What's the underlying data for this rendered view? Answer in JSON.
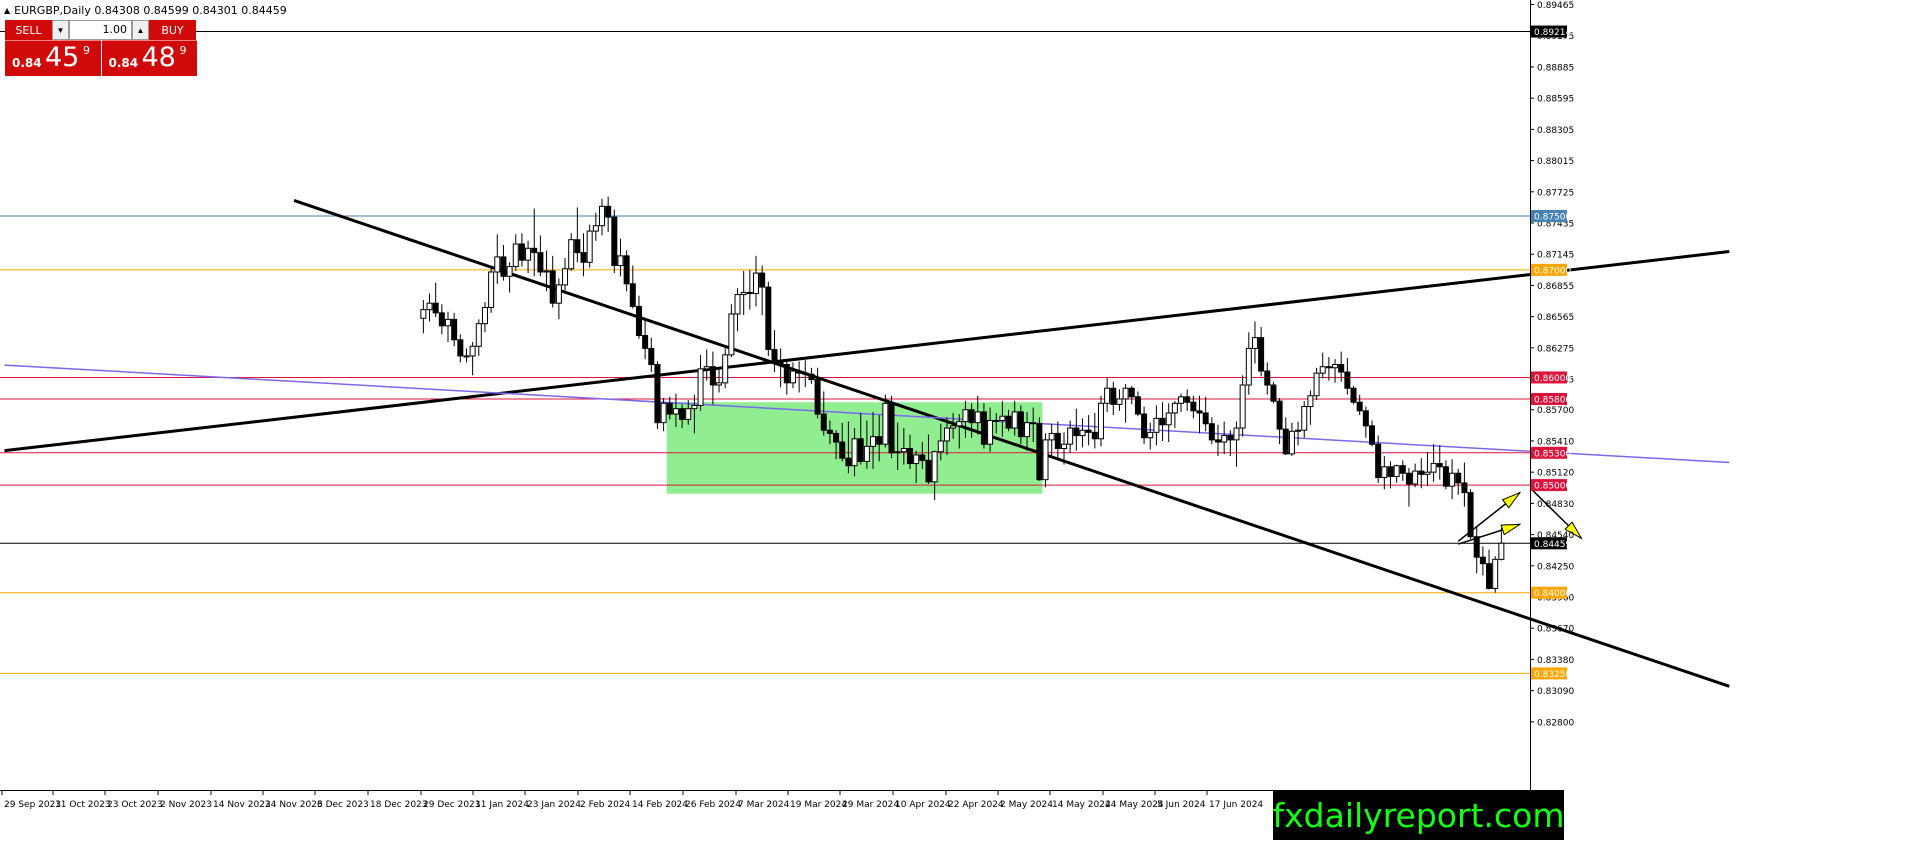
{
  "header": {
    "symbol_line": "EURGBP,Daily  0.84308 0.84599 0.84301 0.84459"
  },
  "trade_panel": {
    "sell_label": "SELL",
    "buy_label": "BUY",
    "lot": "1.00",
    "sell_small": "0.84",
    "sell_big": "45",
    "sell_sup": "9",
    "buy_small": "0.84",
    "buy_big": "48",
    "buy_sup": "9"
  },
  "watermark": "fxdailyreport.com",
  "colors": {
    "candle": "#000000",
    "orange_level": "#ffa500",
    "red_level": "#dc143c",
    "blue_level": "#4682b4",
    "ma_line": "#7b68ee",
    "range_box": "#90ee90",
    "arrow_fill": "#ffff00",
    "trade_red": "#d00a0a",
    "watermark_bg": "#000000",
    "watermark_text": "#12ff12"
  },
  "chart_data": {
    "type": "candlestick",
    "symbol": "EURGBP",
    "timeframe": "Daily",
    "y_range": [
      0.8265,
      0.8947
    ],
    "y_ticks": [
      "0.89465",
      "0.89175",
      "0.88885",
      "0.88595",
      "0.88305",
      "0.88015",
      "0.87725",
      "0.87435",
      "0.87145",
      "0.86855",
      "0.86565",
      "0.86275",
      "0.85985",
      "0.85700",
      "0.85410",
      "0.85120",
      "0.84830",
      "0.84540",
      "0.84250",
      "0.83960",
      "0.83670",
      "0.83380",
      "0.83090",
      "0.82800"
    ],
    "x_labels": [
      "29 Sep 2023",
      "11 Oct 2023",
      "23 Oct 2023",
      "2 Nov 2023",
      "14 Nov 2023",
      "24 Nov 2023",
      "6 Dec 2023",
      "18 Dec 2023",
      "29 Dec 2023",
      "11 Jan 2024",
      "23 Jan 2024",
      "2 Feb 2024",
      "14 Feb 2024",
      "26 Feb 2024",
      "7 Mar 2024",
      "19 Mar 2024",
      "29 Mar 2024",
      "10 Apr 2024",
      "22 Apr 2024",
      "2 May 2024",
      "14 May 2024",
      "24 May 2024",
      "5 Jun 2024",
      "17 Jun 2024"
    ],
    "levels": [
      {
        "price": 0.89214,
        "label": "0.89214",
        "color": "#000000"
      },
      {
        "price": 0.875,
        "label": "0.87500",
        "color": "#4682b4"
      },
      {
        "price": 0.87,
        "label": "0.87000",
        "color": "#ffa500"
      },
      {
        "price": 0.86,
        "label": "0.86000",
        "color": "#dc143c"
      },
      {
        "price": 0.858,
        "label": "0.85800",
        "color": "#dc143c"
      },
      {
        "price": 0.853,
        "label": "0.85300",
        "color": "#dc143c"
      },
      {
        "price": 0.85,
        "label": "0.85000",
        "color": "#dc143c"
      },
      {
        "price": 0.84459,
        "label": "0.84459",
        "color": "#000000"
      },
      {
        "price": 0.84,
        "label": "0.84000",
        "color": "#ffa500"
      },
      {
        "price": 0.8325,
        "label": "0.83250",
        "color": "#ffa500"
      }
    ],
    "trendlines": [
      {
        "name": "descending",
        "from": [
          0,
          0.87645
        ],
        "to": [
          233,
          0.8313
        ]
      },
      {
        "name": "ascending",
        "from": [
          -47,
          0.8532
        ],
        "to": [
          233,
          0.8717
        ]
      },
      {
        "name": "moving-average",
        "from": [
          -47,
          0.86115
        ],
        "to": [
          233,
          0.8521
        ]
      }
    ],
    "range_box": {
      "from": 61,
      "to": 121,
      "top": 0.8577,
      "bottom": 0.8492
    },
    "arrows": [
      {
        "from": [
          189,
          0.84478
        ],
        "to": [
          199,
          0.8493
        ]
      },
      {
        "from": [
          189,
          0.84452
        ],
        "to": [
          199,
          0.84635
        ]
      },
      {
        "from": [
          201,
          0.84955
        ],
        "to": [
          209,
          0.84505
        ]
      }
    ],
    "candles": [
      [
        0.8655,
        0.8672,
        0.8641,
        0.8663
      ],
      [
        0.8663,
        0.8678,
        0.8652,
        0.8669
      ],
      [
        0.8669,
        0.8688,
        0.8656,
        0.866
      ],
      [
        0.866,
        0.8668,
        0.864,
        0.8648
      ],
      [
        0.8648,
        0.8661,
        0.8633,
        0.8654
      ],
      [
        0.8654,
        0.866,
        0.8629,
        0.8635
      ],
      [
        0.8635,
        0.864,
        0.8614,
        0.862
      ],
      [
        0.862,
        0.8627,
        0.8614,
        0.862
      ],
      [
        0.862,
        0.8633,
        0.8602,
        0.8629
      ],
      [
        0.8629,
        0.8654,
        0.862,
        0.865
      ],
      [
        0.865,
        0.867,
        0.8642,
        0.8665
      ],
      [
        0.8665,
        0.8703,
        0.866,
        0.8698
      ],
      [
        0.8698,
        0.8733,
        0.8687,
        0.8712
      ],
      [
        0.8712,
        0.8723,
        0.869,
        0.8694
      ],
      [
        0.8694,
        0.8707,
        0.8679,
        0.8703
      ],
      [
        0.8703,
        0.8733,
        0.8699,
        0.8724
      ],
      [
        0.8724,
        0.8734,
        0.8703,
        0.8709
      ],
      [
        0.8709,
        0.8727,
        0.8697,
        0.872
      ],
      [
        0.872,
        0.8757,
        0.8694,
        0.8716
      ],
      [
        0.8716,
        0.8732,
        0.8694,
        0.8698
      ],
      [
        0.8698,
        0.8718,
        0.868,
        0.8699
      ],
      [
        0.8699,
        0.8713,
        0.8665,
        0.8669
      ],
      [
        0.8669,
        0.8692,
        0.8654,
        0.8686
      ],
      [
        0.8686,
        0.8711,
        0.8681,
        0.8701
      ],
      [
        0.8701,
        0.8734,
        0.8699,
        0.8728
      ],
      [
        0.8728,
        0.8758,
        0.8707,
        0.8716
      ],
      [
        0.8716,
        0.8734,
        0.8694,
        0.8707
      ],
      [
        0.8707,
        0.8742,
        0.8702,
        0.8736
      ],
      [
        0.8736,
        0.8753,
        0.8727,
        0.8741
      ],
      [
        0.8741,
        0.8766,
        0.8732,
        0.8759
      ],
      [
        0.8759,
        0.8768,
        0.8735,
        0.8749
      ],
      [
        0.8749,
        0.8756,
        0.8697,
        0.8704
      ],
      [
        0.8704,
        0.8729,
        0.8694,
        0.8713
      ],
      [
        0.8713,
        0.8718,
        0.868,
        0.8687
      ],
      [
        0.8687,
        0.8704,
        0.8664,
        0.8666
      ],
      [
        0.8666,
        0.8676,
        0.8636,
        0.8639
      ],
      [
        0.8639,
        0.8654,
        0.8617,
        0.8627
      ],
      [
        0.8627,
        0.8637,
        0.8605,
        0.8612
      ],
      [
        0.8612,
        0.8615,
        0.8552,
        0.8558
      ],
      [
        0.8558,
        0.8581,
        0.855,
        0.8576
      ],
      [
        0.8576,
        0.8582,
        0.8561,
        0.8566
      ],
      [
        0.8566,
        0.8585,
        0.8554,
        0.8571
      ],
      [
        0.8571,
        0.8575,
        0.8553,
        0.8561
      ],
      [
        0.8561,
        0.8579,
        0.8556,
        0.8571
      ],
      [
        0.8571,
        0.8584,
        0.8548,
        0.8574
      ],
      [
        0.8574,
        0.8621,
        0.8569,
        0.8608
      ],
      [
        0.8608,
        0.8626,
        0.8597,
        0.861
      ],
      [
        0.861,
        0.8624,
        0.8575,
        0.8593
      ],
      [
        0.8593,
        0.8608,
        0.8586,
        0.8595
      ],
      [
        0.8595,
        0.8629,
        0.859,
        0.8621
      ],
      [
        0.8621,
        0.8668,
        0.8619,
        0.8659
      ],
      [
        0.8659,
        0.8683,
        0.8643,
        0.8677
      ],
      [
        0.8677,
        0.8699,
        0.8658,
        0.8679
      ],
      [
        0.8679,
        0.87,
        0.8663,
        0.8678
      ],
      [
        0.8678,
        0.8713,
        0.8666,
        0.8697
      ],
      [
        0.8697,
        0.8704,
        0.8658,
        0.8684
      ],
      [
        0.8684,
        0.8689,
        0.862,
        0.8626
      ],
      [
        0.8626,
        0.8644,
        0.8605,
        0.8615
      ],
      [
        0.8615,
        0.8627,
        0.8591,
        0.8612
      ],
      [
        0.8612,
        0.8615,
        0.8584,
        0.8595
      ],
      [
        0.8595,
        0.8614,
        0.859,
        0.8606
      ],
      [
        0.8606,
        0.8615,
        0.8586,
        0.8604
      ],
      [
        0.8604,
        0.8616,
        0.8591,
        0.8603
      ],
      [
        0.8603,
        0.8609,
        0.8594,
        0.8598
      ],
      [
        0.8598,
        0.8609,
        0.8562,
        0.8566
      ],
      [
        0.8566,
        0.8587,
        0.8546,
        0.8551
      ],
      [
        0.8551,
        0.856,
        0.8538,
        0.8548
      ],
      [
        0.8548,
        0.8551,
        0.8524,
        0.854
      ],
      [
        0.854,
        0.8558,
        0.8522,
        0.8525
      ],
      [
        0.8525,
        0.8559,
        0.8511,
        0.8518
      ],
      [
        0.8518,
        0.8553,
        0.8508,
        0.8543
      ],
      [
        0.8543,
        0.8567,
        0.8519,
        0.8522
      ],
      [
        0.8522,
        0.856,
        0.8515,
        0.8536
      ],
      [
        0.8536,
        0.8568,
        0.8515,
        0.8545
      ],
      [
        0.8545,
        0.8565,
        0.8522,
        0.8538
      ],
      [
        0.8538,
        0.8584,
        0.8535,
        0.8576
      ],
      [
        0.8576,
        0.8583,
        0.8525,
        0.853
      ],
      [
        0.853,
        0.8558,
        0.8514,
        0.8531
      ],
      [
        0.8531,
        0.8553,
        0.8519,
        0.8534
      ],
      [
        0.8534,
        0.8547,
        0.8515,
        0.852
      ],
      [
        0.852,
        0.8532,
        0.8502,
        0.8528
      ],
      [
        0.8528,
        0.854,
        0.8515,
        0.8523
      ],
      [
        0.8523,
        0.8547,
        0.8501,
        0.8503
      ],
      [
        0.8503,
        0.8532,
        0.8486,
        0.8531
      ],
      [
        0.8531,
        0.8557,
        0.8523,
        0.8541
      ],
      [
        0.8541,
        0.8563,
        0.8528,
        0.8553
      ],
      [
        0.8553,
        0.8567,
        0.8543,
        0.8555
      ],
      [
        0.8555,
        0.8566,
        0.8534,
        0.8559
      ],
      [
        0.8559,
        0.8578,
        0.8544,
        0.857
      ],
      [
        0.857,
        0.8576,
        0.8544,
        0.8558
      ],
      [
        0.8558,
        0.8583,
        0.8547,
        0.8568
      ],
      [
        0.8568,
        0.8576,
        0.8534,
        0.8538
      ],
      [
        0.8538,
        0.8572,
        0.8531,
        0.856
      ],
      [
        0.856,
        0.8567,
        0.8548,
        0.856
      ],
      [
        0.856,
        0.8578,
        0.8545,
        0.8564
      ],
      [
        0.8564,
        0.857,
        0.855,
        0.8553
      ],
      [
        0.8553,
        0.8578,
        0.8546,
        0.8568
      ],
      [
        0.8568,
        0.8574,
        0.8538,
        0.8545
      ],
      [
        0.8545,
        0.8568,
        0.8532,
        0.8558
      ],
      [
        0.8558,
        0.8572,
        0.854,
        0.8557
      ],
      [
        0.8557,
        0.8563,
        0.8504,
        0.8505
      ],
      [
        0.8505,
        0.8548,
        0.8498,
        0.8542
      ],
      [
        0.8542,
        0.8557,
        0.8527,
        0.8548
      ],
      [
        0.8548,
        0.8559,
        0.8524,
        0.8534
      ],
      [
        0.8534,
        0.8549,
        0.8519,
        0.8538
      ],
      [
        0.8538,
        0.856,
        0.853,
        0.8553
      ],
      [
        0.8553,
        0.8571,
        0.8532,
        0.8546
      ],
      [
        0.8546,
        0.8562,
        0.8535,
        0.8551
      ],
      [
        0.8551,
        0.8565,
        0.8537,
        0.8549
      ],
      [
        0.8549,
        0.8567,
        0.8534,
        0.8543
      ],
      [
        0.8543,
        0.8583,
        0.8536,
        0.8576
      ],
      [
        0.8576,
        0.86,
        0.8568,
        0.859
      ],
      [
        0.859,
        0.8596,
        0.8565,
        0.8575
      ],
      [
        0.8575,
        0.8589,
        0.8569,
        0.858
      ],
      [
        0.858,
        0.8594,
        0.8558,
        0.859
      ],
      [
        0.859,
        0.8592,
        0.8575,
        0.8582
      ],
      [
        0.8582,
        0.8587,
        0.8564,
        0.8566
      ],
      [
        0.8566,
        0.8573,
        0.8538,
        0.8544
      ],
      [
        0.8544,
        0.8558,
        0.8533,
        0.8549
      ],
      [
        0.8549,
        0.8574,
        0.8537,
        0.8562
      ],
      [
        0.8562,
        0.8577,
        0.8541,
        0.8556
      ],
      [
        0.8556,
        0.8576,
        0.854,
        0.8567
      ],
      [
        0.8567,
        0.8578,
        0.8553,
        0.8576
      ],
      [
        0.8576,
        0.8585,
        0.8568,
        0.8582
      ],
      [
        0.8582,
        0.8589,
        0.8569,
        0.8577
      ],
      [
        0.8577,
        0.8583,
        0.8562,
        0.8569
      ],
      [
        0.8569,
        0.8583,
        0.8548,
        0.8567
      ],
      [
        0.8567,
        0.8582,
        0.855,
        0.8557
      ],
      [
        0.8557,
        0.8563,
        0.8538,
        0.8542
      ],
      [
        0.8542,
        0.8556,
        0.8527,
        0.854
      ],
      [
        0.854,
        0.8559,
        0.8529,
        0.8546
      ],
      [
        0.8546,
        0.8551,
        0.8527,
        0.8542
      ],
      [
        0.8542,
        0.8559,
        0.8517,
        0.8553
      ],
      [
        0.8553,
        0.8602,
        0.8545,
        0.8593
      ],
      [
        0.8593,
        0.8642,
        0.8584,
        0.8627
      ],
      [
        0.8627,
        0.8652,
        0.8613,
        0.8637
      ],
      [
        0.8637,
        0.8647,
        0.8601,
        0.8606
      ],
      [
        0.8606,
        0.8614,
        0.8584,
        0.8593
      ],
      [
        0.8593,
        0.8596,
        0.8576,
        0.8578
      ],
      [
        0.8578,
        0.8581,
        0.8538,
        0.8552
      ],
      [
        0.8552,
        0.8563,
        0.8528,
        0.8529
      ],
      [
        0.8529,
        0.8558,
        0.8527,
        0.855
      ],
      [
        0.855,
        0.8559,
        0.8537,
        0.8551
      ],
      [
        0.8551,
        0.8578,
        0.8544,
        0.8573
      ],
      [
        0.8573,
        0.8588,
        0.8556,
        0.8583
      ],
      [
        0.8583,
        0.8609,
        0.8579,
        0.8604
      ],
      [
        0.8604,
        0.8623,
        0.8599,
        0.861
      ],
      [
        0.861,
        0.8619,
        0.8597,
        0.8609
      ],
      [
        0.8609,
        0.8617,
        0.8595,
        0.8612
      ],
      [
        0.8612,
        0.8624,
        0.8596,
        0.8605
      ],
      [
        0.8605,
        0.8618,
        0.8584,
        0.859
      ],
      [
        0.859,
        0.8592,
        0.8575,
        0.8577
      ],
      [
        0.8577,
        0.8584,
        0.8565,
        0.8569
      ],
      [
        0.8569,
        0.8573,
        0.8544,
        0.8555
      ],
      [
        0.8555,
        0.856,
        0.8536,
        0.8538
      ],
      [
        0.8538,
        0.8546,
        0.8502,
        0.8507
      ],
      [
        0.8507,
        0.8527,
        0.8496,
        0.8517
      ],
      [
        0.8517,
        0.8522,
        0.8497,
        0.8508
      ],
      [
        0.8508,
        0.8519,
        0.8502,
        0.8518
      ],
      [
        0.8518,
        0.8523,
        0.8504,
        0.8511
      ],
      [
        0.8511,
        0.8516,
        0.848,
        0.8501
      ],
      [
        0.8501,
        0.852,
        0.8498,
        0.8513
      ],
      [
        0.8513,
        0.8525,
        0.8497,
        0.851
      ],
      [
        0.851,
        0.8531,
        0.8499,
        0.8512
      ],
      [
        0.8512,
        0.8538,
        0.8503,
        0.852
      ],
      [
        0.852,
        0.8537,
        0.8505,
        0.8517
      ],
      [
        0.8517,
        0.8523,
        0.8496,
        0.8499
      ],
      [
        0.8499,
        0.8524,
        0.8487,
        0.8511
      ],
      [
        0.8511,
        0.8515,
        0.8491,
        0.8502
      ],
      [
        0.8502,
        0.8521,
        0.848,
        0.8493
      ],
      [
        0.8493,
        0.8496,
        0.845,
        0.8452
      ],
      [
        0.8452,
        0.8461,
        0.8418,
        0.8433
      ],
      [
        0.8433,
        0.8443,
        0.8416,
        0.8427
      ],
      [
        0.8427,
        0.844,
        0.8403,
        0.8404
      ],
      [
        0.8404,
        0.8434,
        0.84,
        0.8431
      ],
      [
        0.8431,
        0.846,
        0.843,
        0.8446
      ]
    ]
  }
}
